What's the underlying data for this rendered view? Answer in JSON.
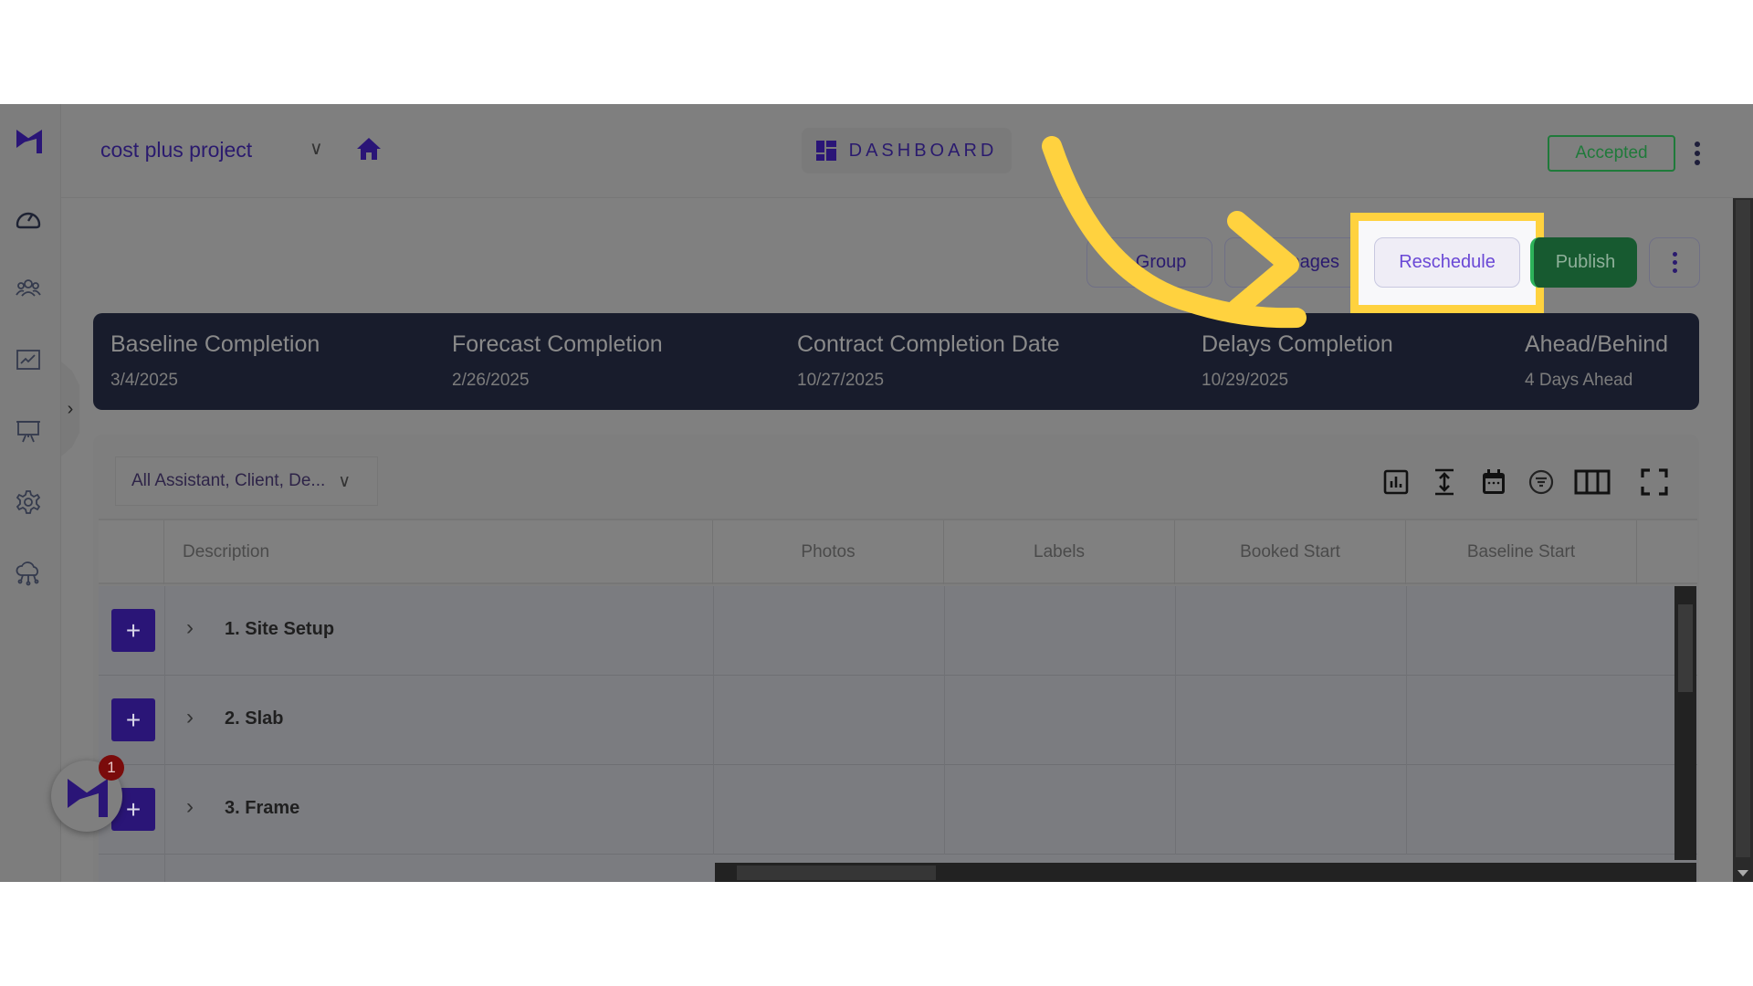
{
  "header": {
    "project_name": "cost plus project",
    "dashboard_label": "DASHBOARD",
    "status_badge": "Accepted"
  },
  "sidebar": {
    "items": [
      {
        "name": "dashboard-gauge",
        "icon": "speedometer-icon"
      },
      {
        "name": "team",
        "icon": "users-icon"
      },
      {
        "name": "reports",
        "icon": "line-chart-icon"
      },
      {
        "name": "presentation",
        "icon": "presentation-board-icon"
      },
      {
        "name": "settings",
        "icon": "gear-icon"
      },
      {
        "name": "cloud-integrations",
        "icon": "cloud-network-icon"
      }
    ],
    "toggle": "›"
  },
  "actions": {
    "group_label": "Group",
    "pages_label": "pages",
    "reschedule_label": "Reschedule",
    "publish_label": "Publish"
  },
  "summary": [
    {
      "label": "Baseline Completion",
      "value": "3/4/2025"
    },
    {
      "label": "Forecast Completion",
      "value": "2/26/2025"
    },
    {
      "label": "Contract Completion Date",
      "value": "10/27/2025"
    },
    {
      "label": "Delays Completion",
      "value": "10/29/2025"
    },
    {
      "label": "Ahead/Behind",
      "value": "4 Days Ahead"
    }
  ],
  "toolbar": {
    "filter_value": "All Assistant, Client, De...",
    "icons": [
      "bar-chart-icon",
      "row-height-icon",
      "calendar-icon",
      "filter-icon",
      "columns-icon",
      "fullscreen-icon"
    ]
  },
  "table": {
    "columns": [
      "",
      "Description",
      "Photos",
      "Labels",
      "Booked Start",
      "Baseline Start"
    ],
    "rows": [
      {
        "title": "1. Site Setup"
      },
      {
        "title": "2. Slab"
      },
      {
        "title": "3. Frame"
      }
    ]
  },
  "notification": {
    "count": "1"
  },
  "annotation": {
    "highlight_color": "#ffd23f",
    "target": "Reschedule"
  }
}
